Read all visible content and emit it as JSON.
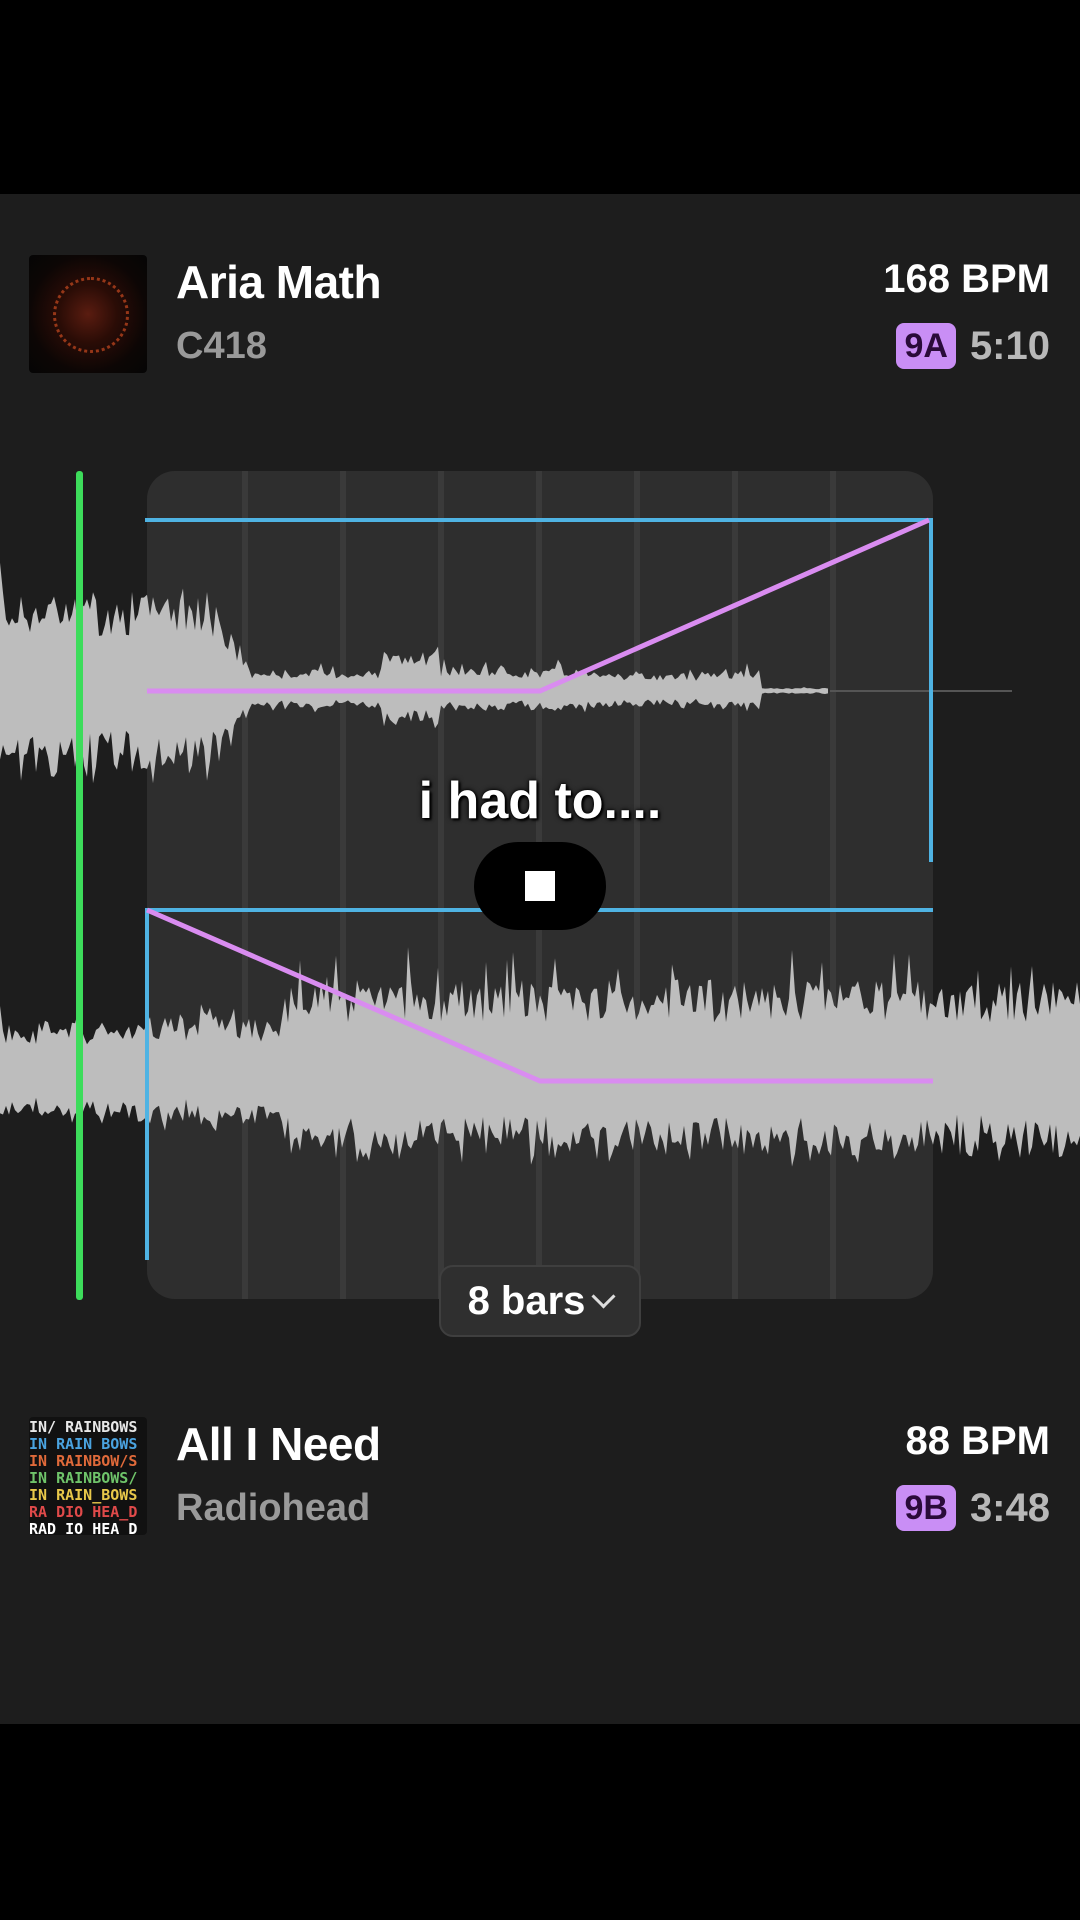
{
  "deck_a": {
    "title": "Aria Math",
    "artist": "C418",
    "bpm": "168 BPM",
    "key": "9A",
    "duration": "5:10"
  },
  "deck_b": {
    "title": "All I Need",
    "artist": "Radiohead",
    "bpm": "88 BPM",
    "key": "9B",
    "duration": "3:48",
    "album_art_text": [
      "IN/ RAINBOWS",
      "IN RAIN BOWS",
      "IN RAINBOW/S",
      "IN RAINBOWS/",
      "IN RAIN_BOWS",
      "RA DIO HEA_D",
      "RAD IO HEA D"
    ]
  },
  "transition": {
    "length_label": "8 bars",
    "caption": "i had to....",
    "playing": true
  },
  "colors": {
    "accent_key": "#c98ef5",
    "volume_line": "#d98cf0",
    "region_line": "#4fb3e3",
    "playhead": "#3ddc5b",
    "waveform": "#bdbdbd"
  },
  "icons": {
    "stop": "stop-icon",
    "dropdown": "chevron-down-icon"
  }
}
